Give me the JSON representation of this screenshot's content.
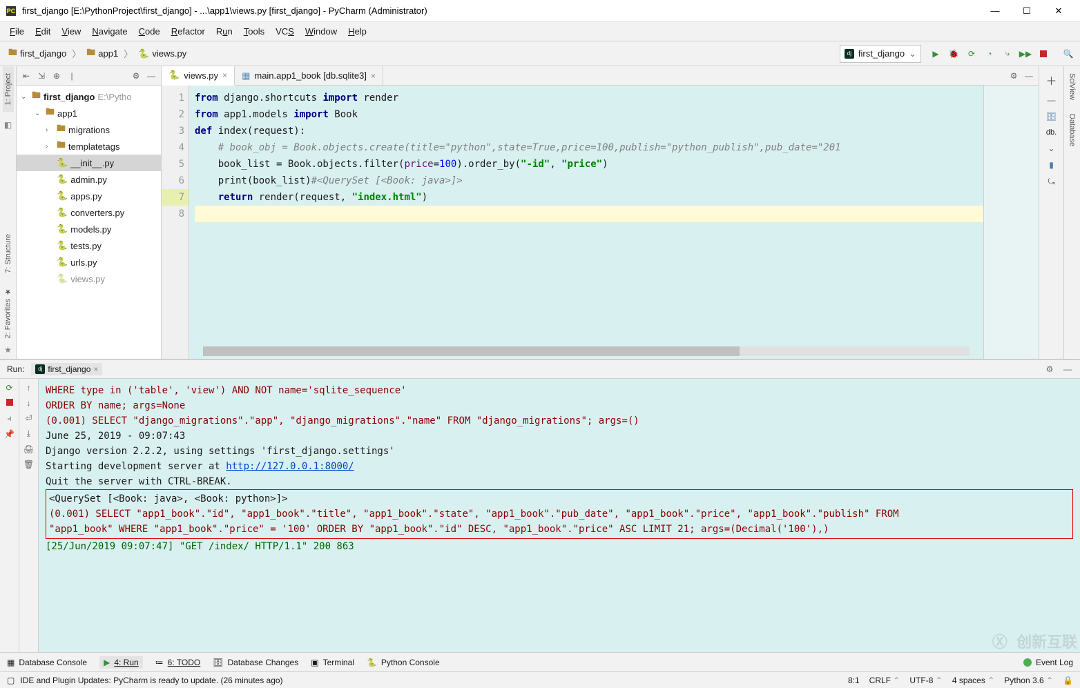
{
  "titlebar": {
    "text": "first_django [E:\\PythonProject\\first_django] - ...\\app1\\views.py [first_django] - PyCharm (Administrator)"
  },
  "menus": [
    "File",
    "Edit",
    "View",
    "Navigate",
    "Code",
    "Refactor",
    "Run",
    "Tools",
    "VCS",
    "Window",
    "Help"
  ],
  "breadcrumb": [
    {
      "label": "first_django",
      "type": "folder"
    },
    {
      "label": "app1",
      "type": "folder"
    },
    {
      "label": "views.py",
      "type": "py"
    }
  ],
  "runConfig": {
    "name": "first_django"
  },
  "editorTabs": [
    {
      "label": "views.py",
      "type": "py",
      "active": true
    },
    {
      "label": "main.app1_book [db.sqlite3]",
      "type": "db",
      "active": false
    }
  ],
  "project": {
    "root": {
      "label": "first_django",
      "hint": "E:\\Pytho"
    },
    "app": {
      "label": "app1"
    },
    "subfolders": [
      "migrations",
      "templatetags"
    ],
    "files": [
      "__init__.py",
      "admin.py",
      "apps.py",
      "converters.py",
      "models.py",
      "tests.py",
      "urls.py",
      "views.py"
    ],
    "views_truncated": "views.py"
  },
  "code": {
    "l1": {
      "a": "from",
      "b": " django.shortcuts ",
      "c": "import",
      "d": " render"
    },
    "l2": {
      "a": "from",
      "b": " app1.models ",
      "c": "import",
      "d": " Book"
    },
    "l3": {
      "a": "def ",
      "b": "index(request):"
    },
    "l4": "    # book_obj = Book.objects.create(title=\"python\",state=True,price=100,publish=\"python_publish\",pub_date=\"201",
    "l5": {
      "a": "    book_list = Book.objects.filter(",
      "p": "price",
      "eq": "=",
      "n": "100",
      "b": ").order_by(",
      "s1": "\"-id\"",
      "c": ", ",
      "s2": "\"price\"",
      "d": ")"
    },
    "l6": {
      "a": "    print(book_list)",
      "cm": "#<QuerySet [<Book: java>]>"
    },
    "l7": {
      "a": "    ",
      "ret": "return",
      "b": " render(request, ",
      "s": "\"index.html\"",
      "c": ")"
    }
  },
  "run": {
    "name": "first_django",
    "title": "Run:",
    "lines": {
      "l1": "           WHERE type in ('table', 'view') AND NOT name='sqlite_sequence'",
      "l2": "           ORDER BY name; args=None",
      "l3": "(0.001) SELECT \"django_migrations\".\"app\", \"django_migrations\".\"name\" FROM \"django_migrations\"; args=()",
      "l4": "June 25, 2019 - 09:07:43",
      "l5": "Django version 2.2.2, using settings 'first_django.settings'",
      "l6a": "Starting development server at ",
      "l6b": "http://127.0.0.1:8000/",
      "l7": "Quit the server with CTRL-BREAK.",
      "l8": "<QuerySet [<Book: java>, <Book: python>]>",
      "l9": "(0.001) SELECT \"app1_book\".\"id\", \"app1_book\".\"title\", \"app1_book\".\"state\", \"app1_book\".\"pub_date\", \"app1_book\".\"price\", \"app1_book\".\"publish\" FROM",
      "l10": " \"app1_book\" WHERE \"app1_book\".\"price\" = '100' ORDER BY \"app1_book\".\"id\" DESC, \"app1_book\".\"price\" ASC  LIMIT 21; args=(Decimal('100'),)",
      "l11": "[25/Jun/2019 09:07:47] \"GET /index/ HTTP/1.1\" 200 863"
    }
  },
  "bottomTabs": {
    "db": "Database Console",
    "run": "4: Run",
    "todo": "6: TODO",
    "dbc": "Database Changes",
    "term": "Terminal",
    "pycon": "Python Console",
    "eventlog": "Event Log"
  },
  "status": {
    "msg": "IDE and Plugin Updates: PyCharm is ready to update. (26 minutes ago)",
    "pos": "8:1",
    "crlf": "CRLF",
    "enc": "UTF-8",
    "indent": "4 spaces",
    "python": "Python 3.6"
  },
  "sideTabs": {
    "project": "1: Project",
    "structure": "7: Structure",
    "favorites": "2: Favorites",
    "sciview": "SciView",
    "database": "Database",
    "db": "db."
  }
}
